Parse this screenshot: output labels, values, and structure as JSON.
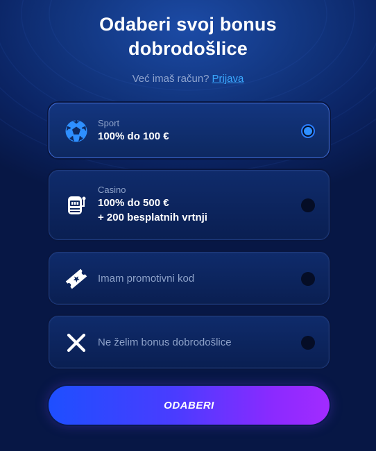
{
  "header": {
    "title_line1": "Odaberi svoj bonus",
    "title_line2": "dobrodošlice",
    "login_prompt": "Već imaš račun?",
    "login_link": "Prijava"
  },
  "options": [
    {
      "icon": "soccer-ball-icon",
      "label": "Sport",
      "value_line1": "100% do 100 €",
      "selected": true
    },
    {
      "icon": "slot-machine-icon",
      "label": "Casino",
      "value_line1": "100% do 500 €",
      "value_line2": "+ 200 besplatnih vrtnji",
      "selected": false
    },
    {
      "icon": "ticket-icon",
      "text": "Imam promotivni kod",
      "selected": false
    },
    {
      "icon": "close-icon",
      "text": "Ne želim bonus dobrodošlice",
      "selected": false
    }
  ],
  "submit_label": "ODABERI",
  "colors": {
    "accent_blue": "#2e8fff",
    "link": "#3aa8ff",
    "cta_start": "#1e4fff",
    "cta_end": "#a22bff"
  }
}
